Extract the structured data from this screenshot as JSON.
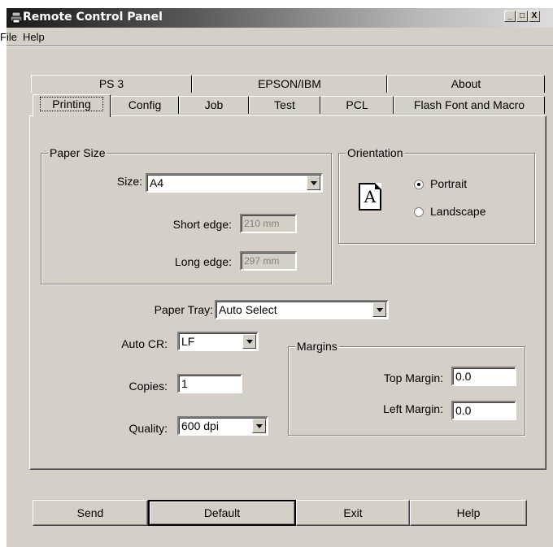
{
  "window": {
    "title": "Remote Control Panel",
    "controls": [
      "_",
      "□",
      "X"
    ]
  },
  "menu": {
    "items": [
      "File",
      "Help"
    ]
  },
  "tabs": {
    "row1": [
      "PS 3",
      "EPSON/IBM",
      "About"
    ],
    "row2": [
      "Printing",
      "Config",
      "Job",
      "Test",
      "PCL",
      "Flash Font and Macro"
    ],
    "active": "Printing"
  },
  "paper_size": {
    "group_label": "Paper Size",
    "size_label": "Size:",
    "size_value": "A4",
    "short_edge_label": "Short edge:",
    "short_edge_value": "210 mm",
    "long_edge_label": "Long edge:",
    "long_edge_value": "297 mm"
  },
  "orientation": {
    "group_label": "Orientation",
    "icon_letter": "A",
    "portrait_label": "Portrait",
    "landscape_label": "Landscape",
    "selected": "Portrait"
  },
  "paper_tray": {
    "label": "Paper Tray:",
    "value": "Auto Select"
  },
  "auto_cr": {
    "label": "Auto CR:",
    "value": "LF"
  },
  "copies": {
    "label": "Copies:",
    "value": "1"
  },
  "quality": {
    "label": "Quality:",
    "value": "600 dpi"
  },
  "margins": {
    "group_label": "Margins",
    "top_label": "Top Margin:",
    "top_value": "0.0",
    "left_label": "Left Margin:",
    "left_value": "0.0"
  },
  "buttons": {
    "send": "Send",
    "default": "Default",
    "exit": "Exit",
    "help": "Help"
  }
}
